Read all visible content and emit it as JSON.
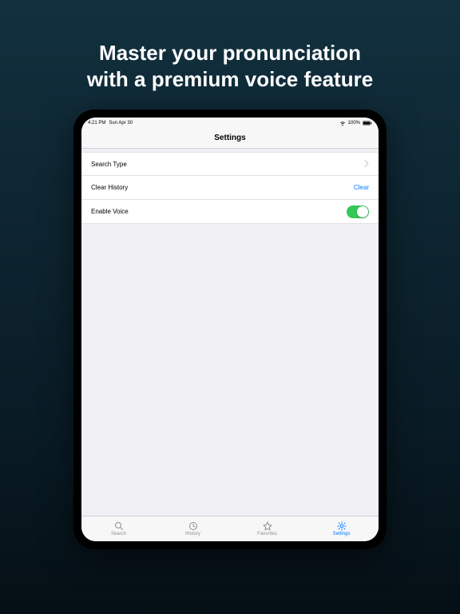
{
  "promo": {
    "headline_line1": "Master your pronunciation",
    "headline_line2": "with a premium voice feature"
  },
  "statusbar": {
    "time": "4:21 PM",
    "date": "Sun Apr 30",
    "signal": "wifi",
    "battery_text": "100%"
  },
  "navbar": {
    "title": "Settings"
  },
  "settings_rows": {
    "row0": {
      "label": "Search Type",
      "kind": "disclosure"
    },
    "row1": {
      "label": "Clear History",
      "action": "Clear",
      "kind": "action"
    },
    "row2": {
      "label": "Enable Voice",
      "kind": "toggle",
      "value": true
    }
  },
  "tabbar": {
    "tabs": {
      "t0": {
        "label": "Search",
        "icon": "search-icon",
        "active": false
      },
      "t1": {
        "label": "History",
        "icon": "history-icon",
        "active": false
      },
      "t2": {
        "label": "Favorites",
        "icon": "star-icon",
        "active": false
      },
      "t3": {
        "label": "Settings",
        "icon": "gear-icon",
        "active": true
      }
    }
  },
  "colors": {
    "accent": "#007aff",
    "toggle_on": "#34c759"
  }
}
